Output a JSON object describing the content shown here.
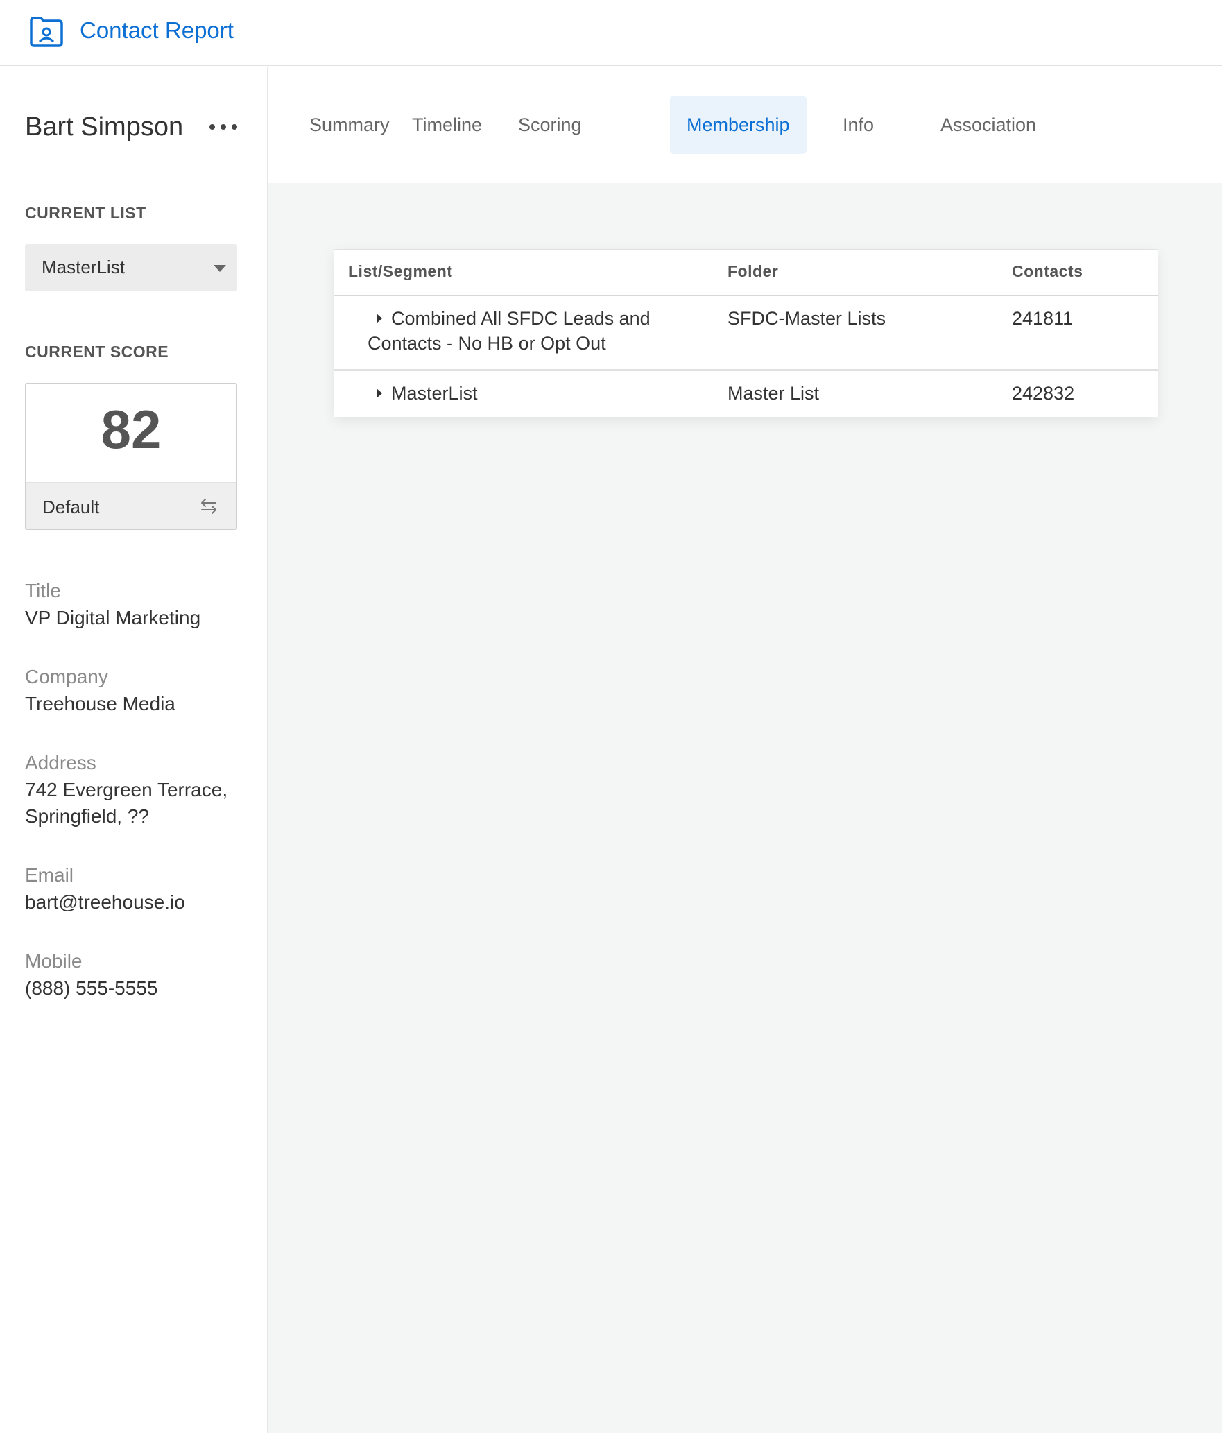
{
  "header": {
    "title": "Contact Report",
    "icon": "contact-folder-icon"
  },
  "contact": {
    "name": "Bart Simpson"
  },
  "current_list": {
    "label": "CURRENT LIST",
    "selected": "MasterList"
  },
  "current_score": {
    "label": "CURRENT SCORE",
    "value": "82",
    "model": "Default"
  },
  "fields": [
    {
      "label": "Title",
      "value": "VP Digital Marketing"
    },
    {
      "label": "Company",
      "value": "Treehouse Media"
    },
    {
      "label": "Address",
      "value": "742 Evergreen Terrace, Springfield, ??"
    },
    {
      "label": "Email",
      "value": "bart@treehouse.io"
    },
    {
      "label": "Mobile",
      "value": "(888) 555-5555"
    }
  ],
  "tabs": [
    {
      "label": "Summary"
    },
    {
      "label": "Timeline"
    },
    {
      "label": "Scoring"
    },
    {
      "label": "Membership",
      "active": true
    },
    {
      "label": "Info"
    },
    {
      "label": "Association"
    }
  ],
  "table": {
    "columns": [
      "List/Segment",
      "Folder",
      "Contacts"
    ],
    "rows": [
      {
        "name_line1": "Combined All SFDC Leads and",
        "name_line2": "Contacts - No HB or Opt Out",
        "folder": "SFDC-Master Lists",
        "contacts": "241811"
      },
      {
        "name_line1": "MasterList",
        "folder": "Master List",
        "contacts": "242832"
      }
    ]
  },
  "colors": {
    "accent": "#0b6fd4",
    "active_tab_bg": "#eaf3fc",
    "main_bg": "#f4f5f5"
  }
}
